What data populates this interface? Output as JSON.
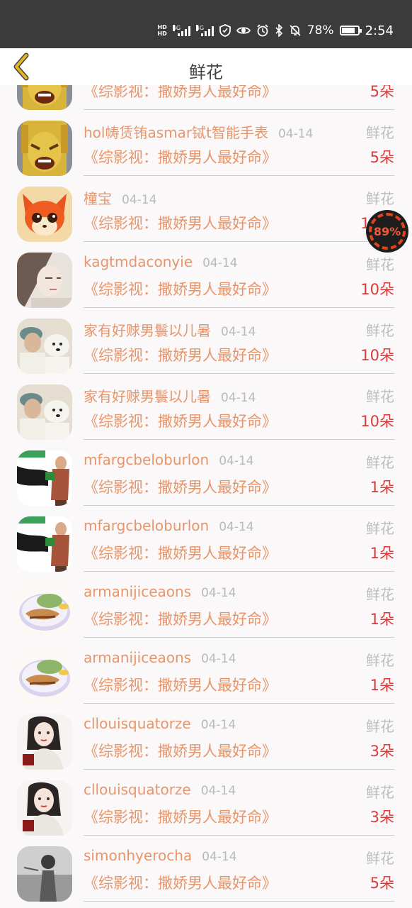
{
  "status_bar": {
    "hd1": "HD",
    "hd2": "HD",
    "net1": "4G",
    "net2": "4G",
    "battery_percent": "78%",
    "battery_level": 0.78,
    "time": "2:54",
    "icons": [
      "eye-icon",
      "alarm-icon",
      "bluetooth-icon",
      "mute-icon",
      "battery-icon"
    ]
  },
  "header": {
    "title": "鲜花",
    "back_icon": "chevron-left-icon",
    "accent": "#d4a017"
  },
  "float_widget": {
    "text": "89%",
    "color": "#e0441c"
  },
  "colors": {
    "name": "#e8956a",
    "date": "#b9b9b9",
    "category": "#bdbdbd",
    "quantity": "#d93a3a"
  },
  "rows": [
    {
      "name": "",
      "date": "",
      "category": "",
      "book": "《综影视：撒娇男人最好命》",
      "qty": "5朵",
      "avatar": "gold-mask"
    },
    {
      "name": "hol帱赁铕asmar铽t智能手表",
      "date": "04-14",
      "category": "鲜花",
      "book": "《综影视：撒娇男人最好命》",
      "qty": "5朵",
      "avatar": "gold-mask"
    },
    {
      "name": "橦宝",
      "date": "04-14",
      "category": "鲜花",
      "book": "《综影视：撒娇男人最好命》",
      "qty": "10朵",
      "avatar": "fox"
    },
    {
      "name": "kagtmdaconyie",
      "date": "04-14",
      "category": "鲜花",
      "book": "《综影视：撒娇男人最好命》",
      "qty": "10朵",
      "avatar": "girl"
    },
    {
      "name": "家有好赇男鬟以儿暑",
      "date": "04-14",
      "category": "鲜花",
      "book": "《综影视：撒娇男人最好命》",
      "qty": "10朵",
      "avatar": "dog"
    },
    {
      "name": "家有好赇男鬟以儿暑",
      "date": "04-14",
      "category": "鲜花",
      "book": "《综影视：撒娇男人最好命》",
      "qty": "10朵",
      "avatar": "dog"
    },
    {
      "name": "mfargcbeloburlon",
      "date": "04-14",
      "category": "鲜花",
      "book": "《综影视：撒娇男人最好命》",
      "qty": "1朵",
      "avatar": "man"
    },
    {
      "name": "mfargcbeloburlon",
      "date": "04-14",
      "category": "鲜花",
      "book": "《综影视：撒娇男人最好命》",
      "qty": "1朵",
      "avatar": "man"
    },
    {
      "name": "armanijiceaons",
      "date": "04-14",
      "category": "鲜花",
      "book": "《综影视：撒娇男人最好命》",
      "qty": "1朵",
      "avatar": "food"
    },
    {
      "name": "armanijiceaons",
      "date": "04-14",
      "category": "鲜花",
      "book": "《综影视：撒娇男人最好命》",
      "qty": "1朵",
      "avatar": "food"
    },
    {
      "name": "cllouisquatorze",
      "date": "04-14",
      "category": "鲜花",
      "book": "《综影视：撒娇男人最好命》",
      "qty": "3朵",
      "avatar": "lady"
    },
    {
      "name": "cllouisquatorze",
      "date": "04-14",
      "category": "鲜花",
      "book": "《综影视：撒娇男人最好命》",
      "qty": "3朵",
      "avatar": "lady"
    },
    {
      "name": "simonhyerocha",
      "date": "04-14",
      "category": "鲜花",
      "book": "《综影视：撒娇男人最好命》",
      "qty": "5朵",
      "avatar": "bw"
    }
  ]
}
